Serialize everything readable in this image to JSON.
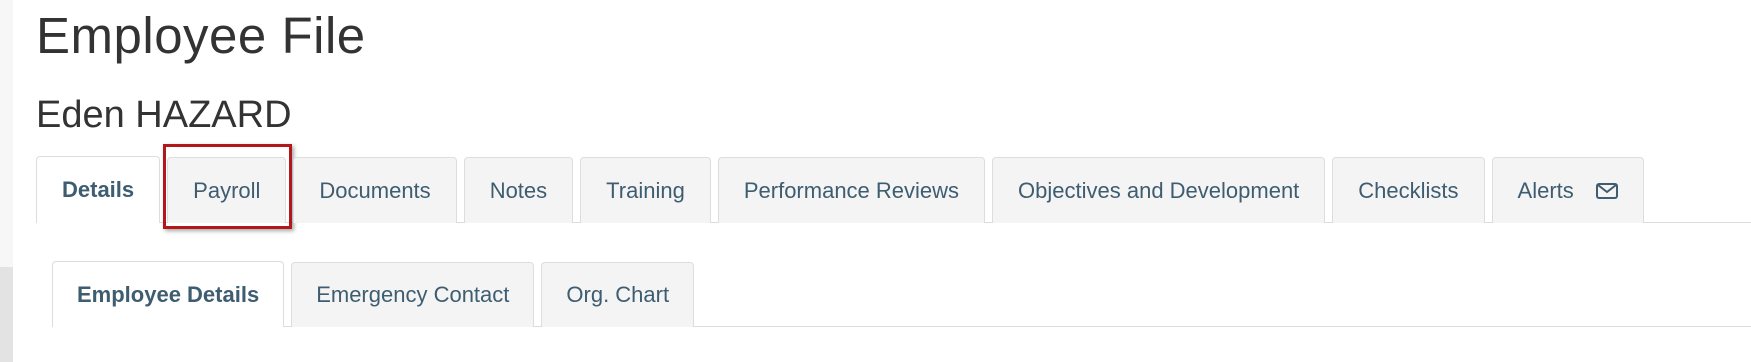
{
  "page_title": "Employee File",
  "employee_name": "Eden HAZARD",
  "primary_tabs": [
    {
      "label": "Details",
      "active": true
    },
    {
      "label": "Payroll",
      "highlighted": true
    },
    {
      "label": "Documents"
    },
    {
      "label": "Notes"
    },
    {
      "label": "Training"
    },
    {
      "label": "Performance Reviews"
    },
    {
      "label": "Objectives and Development"
    },
    {
      "label": "Checklists"
    },
    {
      "label": "Alerts",
      "icon": "envelope-icon"
    }
  ],
  "secondary_tabs": [
    {
      "label": "Employee Details",
      "active": true
    },
    {
      "label": "Emergency Contact"
    },
    {
      "label": "Org. Chart"
    }
  ],
  "colors": {
    "tab_text": "#3e5d70",
    "highlight_border": "#b3171b",
    "heading_text": "#333333"
  }
}
